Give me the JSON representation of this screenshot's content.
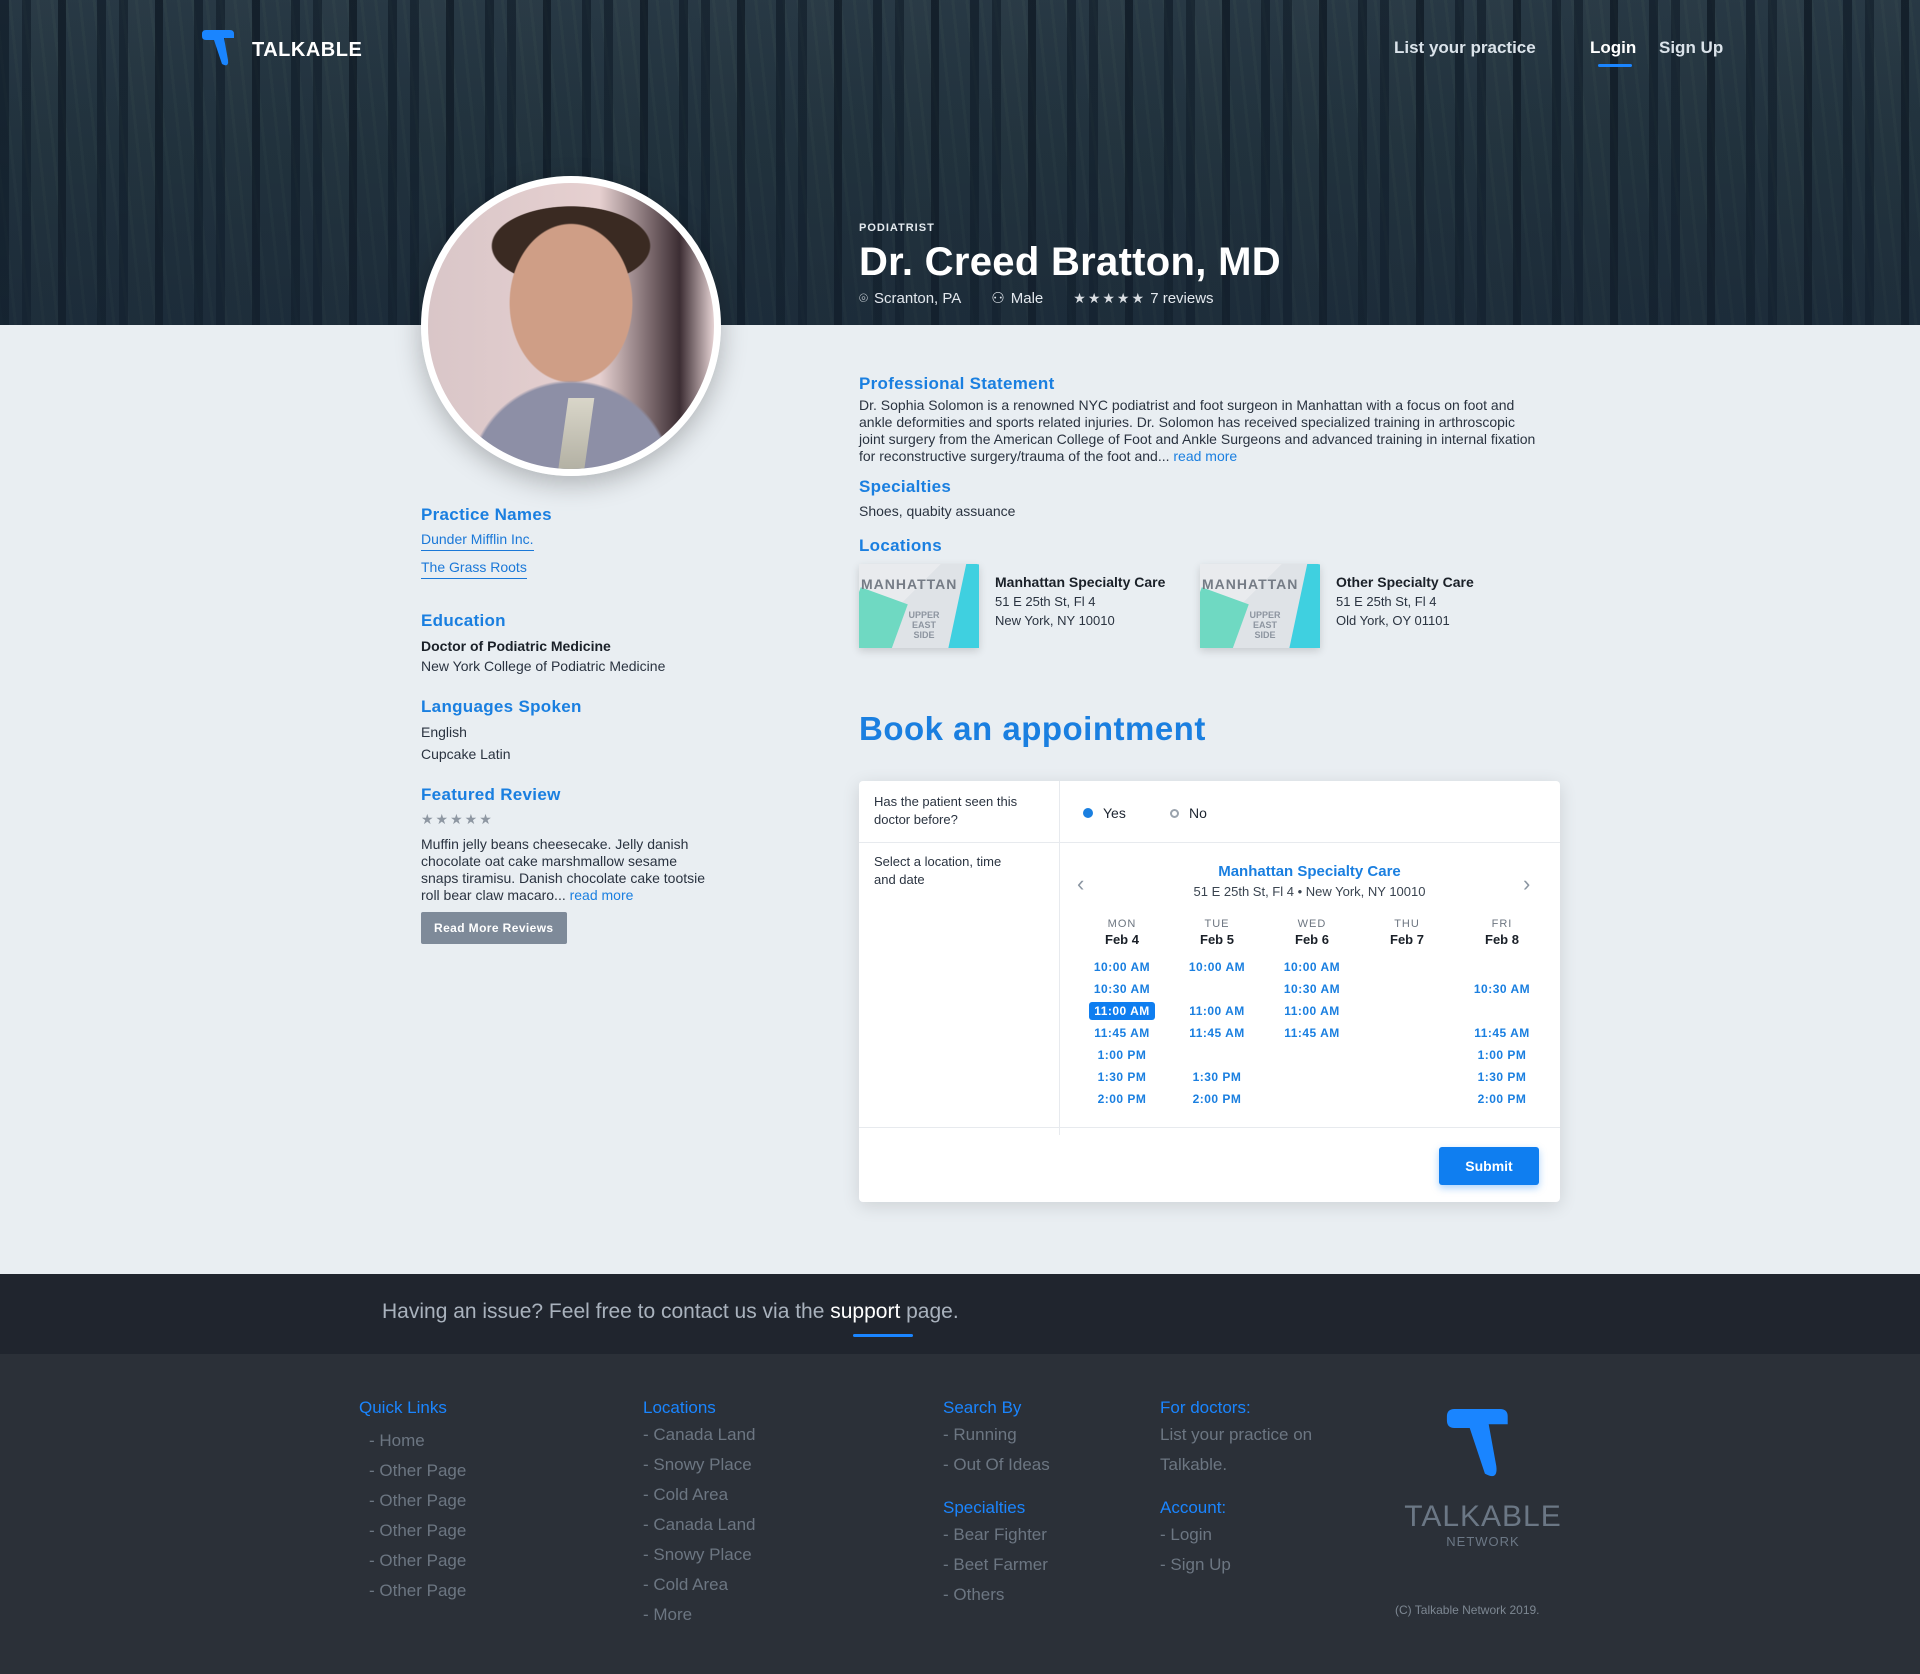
{
  "header": {
    "brand": "TALKABLE",
    "nav": {
      "list_practice": "List your practice",
      "login": "Login",
      "signup": "Sign Up"
    }
  },
  "doctor": {
    "kind": "PODIATRIST",
    "name": "Dr. Creed Bratton, MD",
    "location": "Scranton, PA",
    "gender": "Male",
    "rating": 4.5,
    "stars": "★★★★★",
    "reviews": "7 reviews"
  },
  "left": {
    "practice_title": "Practice Names",
    "practices": [
      "Dunder Mifflin Inc.",
      "The Grass Roots"
    ],
    "education_title": "Education",
    "degree": "Doctor of Podiatric Medicine",
    "school": "New York College of Podiatric Medicine",
    "languages_title": "Languages Spoken",
    "languages": [
      "English",
      "Cupcake Latin"
    ],
    "review_title": "Featured Review",
    "review_stars": "★★★★★",
    "review_text": "Muffin jelly beans cheesecake. Jelly danish chocolate oat cake marshmallow sesame snaps tiramisu. Danish chocolate cake tootsie roll bear claw macaro...",
    "read_more": "read more",
    "read_more_reviews": "Read More Reviews"
  },
  "right": {
    "statement_title": "Professional Statement",
    "statement": "Dr. Sophia Solomon is a renowned NYC podiatrist and foot surgeon in Manhattan with a focus on foot and ankle deformities and sports related injuries. Dr. Solomon has received specialized training in arthroscopic joint surgery from the American College of Foot and Ankle Surgeons and advanced training in internal fixation for reconstructive surgery/trauma of the foot and...",
    "read_more": "read more",
    "specialties_title": "Specialties",
    "specialties": "Shoes, quabity assuance",
    "locations_title": "Locations",
    "map_label": "MANHATTAN",
    "map_sub": "UPPER EAST SIDE",
    "locations": [
      {
        "name": "Manhattan Specialty Care",
        "line1": "51 E 25th St, Fl 4",
        "line2": "New York, NY 10010"
      },
      {
        "name": "Other Specialty Care",
        "line1": "51 E 25th St, Fl 4",
        "line2": "Old York, OY 01101"
      }
    ]
  },
  "booking": {
    "title": "Book an appointment",
    "q1": "Has the patient seen this doctor before?",
    "yes": "Yes",
    "no": "No",
    "q2": "Select a location, time and date",
    "location_name": "Manhattan Specialty Care",
    "location_addr": "51 E 25th St, Fl 4 • New York, NY 10010",
    "days": [
      {
        "dow": "MON",
        "date": "Feb 4"
      },
      {
        "dow": "TUE",
        "date": "Feb 5"
      },
      {
        "dow": "WED",
        "date": "Feb 6"
      },
      {
        "dow": "THU",
        "date": "Feb 7"
      },
      {
        "dow": "FRI",
        "date": "Feb 8"
      }
    ],
    "slots": [
      [
        "10:00 AM",
        "10:30 AM",
        "11:00 AM",
        "11:45 AM",
        "1:00 PM",
        "1:30 PM",
        "2:00 PM"
      ],
      [
        "10:00 AM",
        "",
        "11:00 AM",
        "11:45 AM",
        "",
        "1:30 PM",
        "2:00 PM"
      ],
      [
        "10:00 AM",
        "10:30 AM",
        "11:00 AM",
        "11:45 AM",
        "",
        "",
        ""
      ],
      [
        "",
        "",
        "",
        "",
        "",
        "",
        ""
      ],
      [
        "",
        "10:30 AM",
        "",
        "11:45 AM",
        "1:00 PM",
        "1:30 PM",
        "2:00 PM"
      ]
    ],
    "selected_slot": "11:00 AM",
    "submit": "Submit"
  },
  "support": {
    "before": "Having an issue? Feel free to contact us via the ",
    "link": "support",
    "after": " page."
  },
  "footer": {
    "quick_links_title": "Quick Links",
    "quick_links": [
      "- Home",
      "- Other Page",
      "- Other Page",
      "- Other Page",
      "- Other Page",
      "- Other Page"
    ],
    "locations_title": "Locations",
    "locations": [
      "- Canada Land",
      "- Snowy Place",
      "- Cold Area",
      "- Canada Land",
      "- Snowy Place",
      "- Cold Area",
      "- More"
    ],
    "search_title": "Search By",
    "search": [
      "- Running",
      "- Out Of Ideas"
    ],
    "specialties_title": "Specialties",
    "specialties": [
      "- Bear Fighter",
      "- Beet Farmer",
      "- Others"
    ],
    "doctors_title": "For doctors:",
    "doctors_text": [
      "List your practice on",
      "Talkable."
    ],
    "account_title": "Account:",
    "account": [
      "- Login",
      "- Sign Up"
    ],
    "brand": "TALKABLE",
    "brand_sub": "NETWORK",
    "copyright": "(C) Talkable Network 2019."
  },
  "colors": {
    "accent": "#1a7fe0",
    "dark": "#20252e"
  }
}
